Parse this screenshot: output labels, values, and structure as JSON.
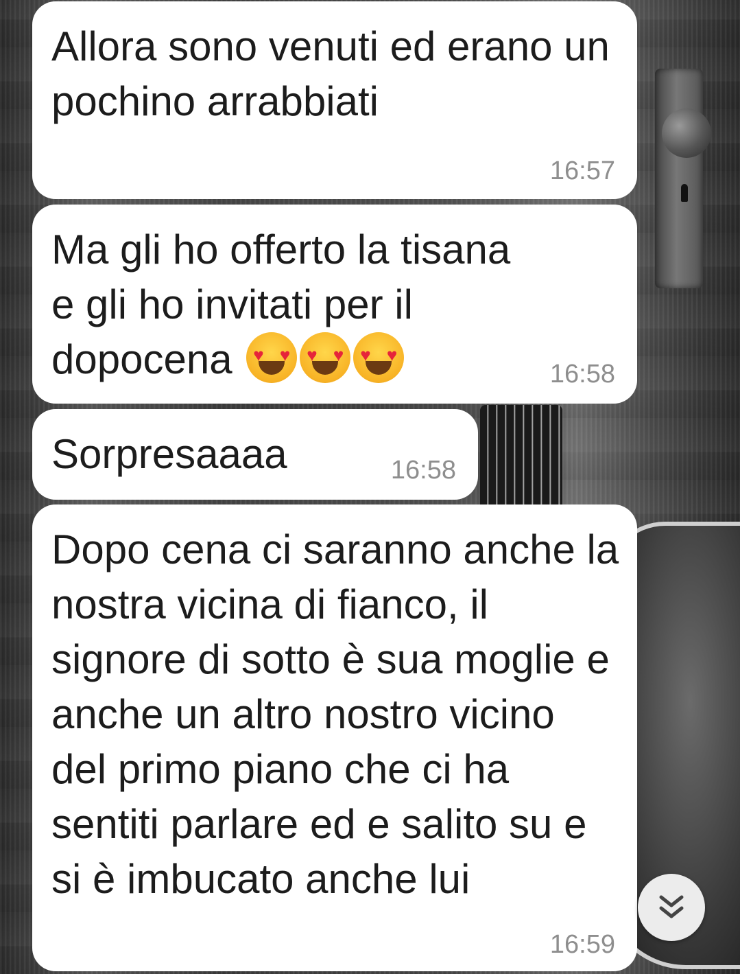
{
  "chat": {
    "messages": [
      {
        "text": "Allora sono venuti ed erano un pochino arrabbiati",
        "time": "16:57"
      },
      {
        "text": "Ma gli ho offerto la tisana e gli ho invitati per il dopocena",
        "emojis": [
          "smiling-face-with-heart-eyes",
          "smiling-face-with-heart-eyes",
          "smiling-face-with-heart-eyes"
        ],
        "time": "16:58"
      },
      {
        "text": "Sorpresaaaa",
        "time": "16:58"
      },
      {
        "text": "Dopo cena ci saranno anche la nostra vicina di fianco, il signore di sotto è sua moglie e anche un altro nostro vicino del primo piano che ci ha sentiti parlare ed e salito su e si è imbucato anche lui",
        "time": "16:59"
      }
    ]
  },
  "scroll_button": {
    "icon": "double-chevron-down-icon"
  },
  "colors": {
    "bubble": "#ffffff",
    "text": "#1c1c1c",
    "time": "#8e8e8e",
    "wallpaper": "#3a3a3a"
  }
}
